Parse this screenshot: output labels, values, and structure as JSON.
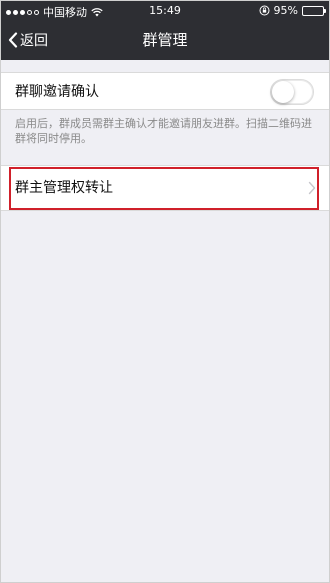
{
  "status_bar": {
    "carrier": "中国移动",
    "time": "15:49",
    "battery": "95%"
  },
  "nav": {
    "back_label": "返回",
    "title": "群管理"
  },
  "settings": {
    "invite_confirm_label": "群聊邀请确认",
    "invite_confirm_enabled": false,
    "invite_confirm_hint": "启用后，群成员需群主确认才能邀请朋友进群。扫描二维码进群将同时停用。",
    "transfer_owner_label": "群主管理权转让"
  },
  "colors": {
    "bar_bg": "#2d2e33",
    "page_bg": "#efeff4",
    "highlight": "#d0202a"
  }
}
